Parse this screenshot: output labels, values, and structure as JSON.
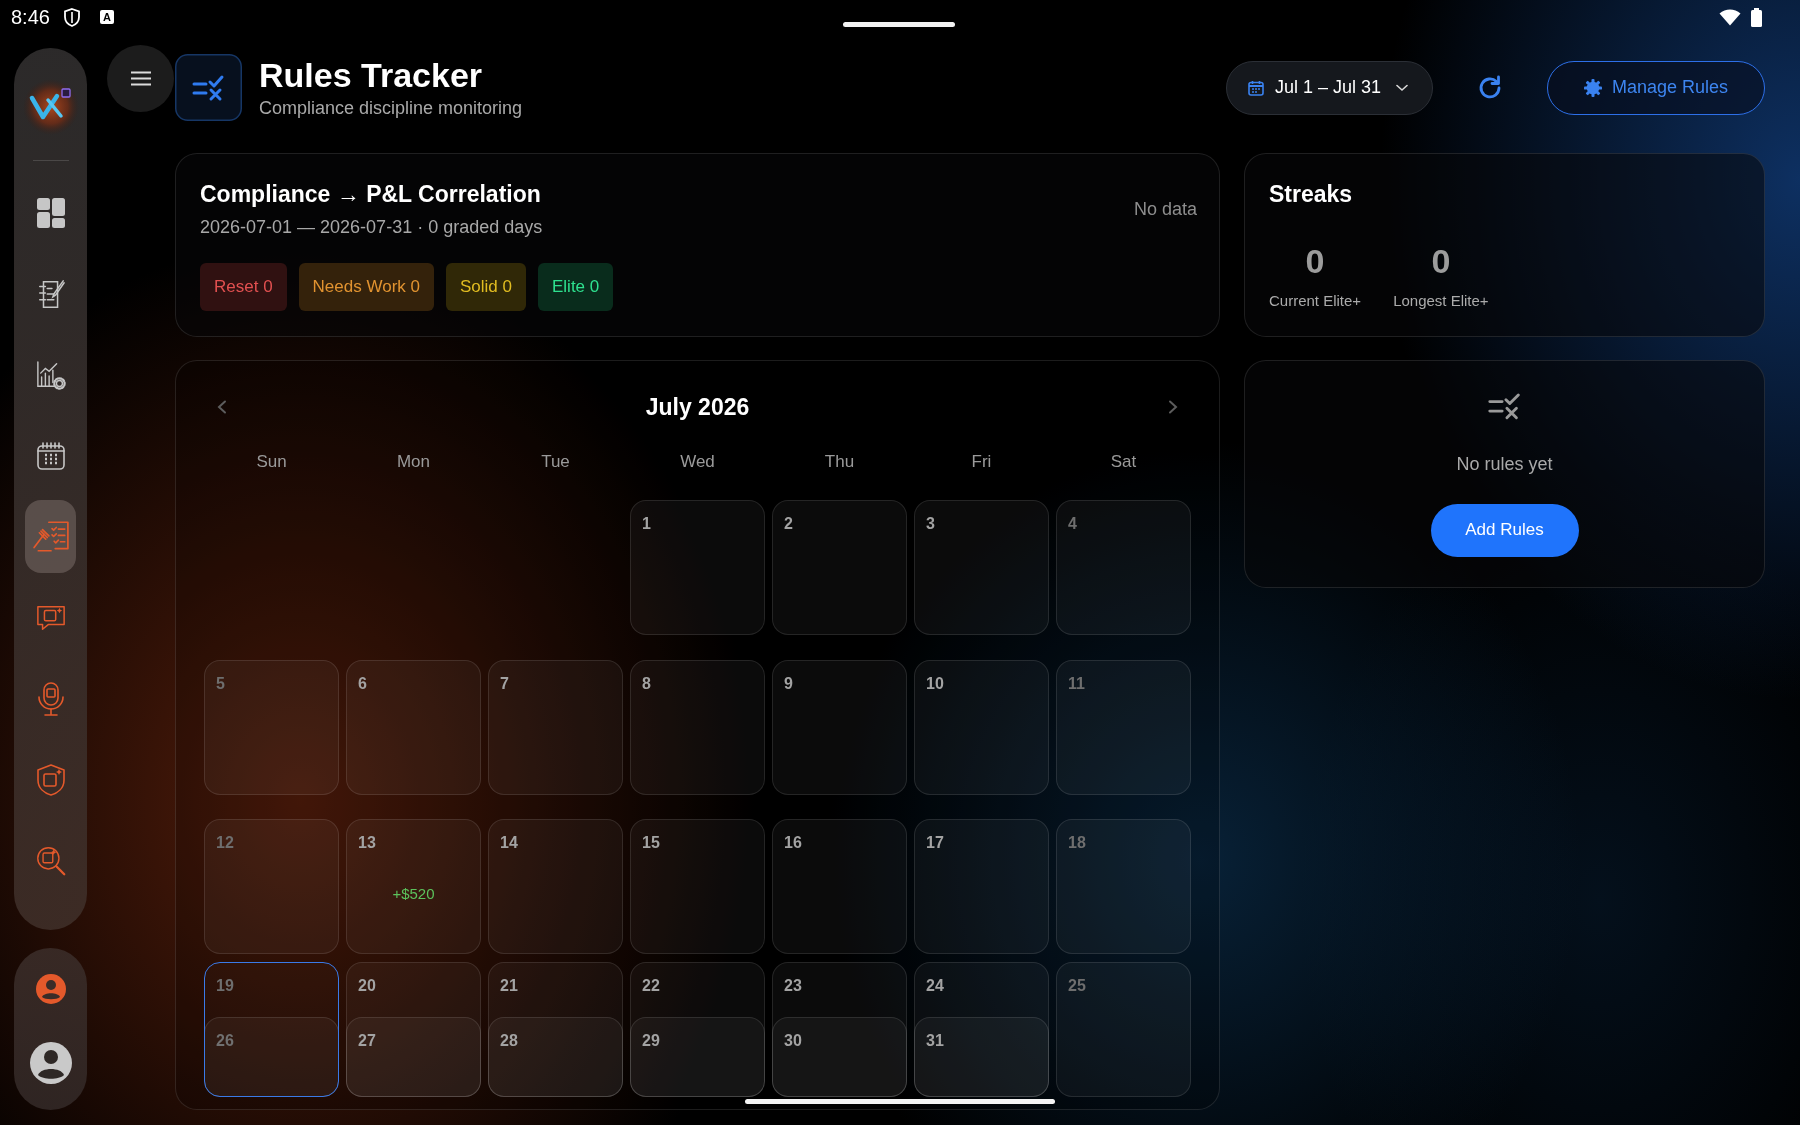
{
  "status_bar": {
    "time": "8:46",
    "notification": "A"
  },
  "sidebar": {
    "items": [
      {
        "selected": false
      },
      {
        "selected": false
      },
      {
        "selected": false
      },
      {
        "selected": false
      },
      {
        "selected": true
      },
      {
        "selected": false
      },
      {
        "selected": false
      },
      {
        "selected": false
      },
      {
        "selected": false
      }
    ]
  },
  "header": {
    "title": "Rules Tracker",
    "subtitle": "Compliance discipline monitoring",
    "date_range": "Jul 1 – Jul 31",
    "manage_button": "Manage Rules"
  },
  "correlation": {
    "title": "Compliance → P&L Correlation",
    "subtitle": "2026-07-01 — 2026-07-31 · 0 graded days",
    "status": "No data",
    "grades": [
      {
        "label": "Reset 0",
        "color": "#301111"
      },
      {
        "label": "Needs Work 0",
        "color": "#34220b"
      },
      {
        "label": "Solid 0",
        "color": "#302807"
      },
      {
        "label": "Elite 0",
        "color": "#092c1c"
      }
    ]
  },
  "streaks": {
    "title": "Streaks",
    "stats": [
      {
        "value": "0",
        "label": "Current Elite+"
      },
      {
        "value": "0",
        "label": "Longest Elite+"
      }
    ]
  },
  "rules": {
    "empty_text": "No rules yet",
    "add_button": "Add Rules"
  },
  "calendar": {
    "month": "July 2026",
    "weekdays": [
      "Sun",
      "Mon",
      "Tue",
      "Wed",
      "Thu",
      "Fri",
      "Sat"
    ],
    "weeks": [
      {
        "days": [
          {
            "label": "1",
            "selected": false
          },
          {
            "label": "2",
            "selected": false
          },
          {
            "label": "3",
            "selected": false
          },
          {
            "label": "4",
            "selected": false
          }
        ]
      },
      {
        "days": [
          {
            "label": "5",
            "selected": false
          },
          {
            "label": "6",
            "selected": false
          },
          {
            "label": "7",
            "selected": false
          },
          {
            "label": "8",
            "selected": false
          },
          {
            "label": "9",
            "selected": false
          },
          {
            "label": "10",
            "selected": false
          },
          {
            "label": "11",
            "selected": false
          }
        ]
      },
      {
        "days": [
          {
            "label": "12",
            "selected": false
          },
          {
            "label": "13",
            "selected": false,
            "pnl": "+$520"
          },
          {
            "label": "14",
            "selected": false
          },
          {
            "label": "15",
            "selected": false
          },
          {
            "label": "16",
            "selected": false
          },
          {
            "label": "17",
            "selected": false
          },
          {
            "label": "18",
            "selected": false
          }
        ]
      },
      {
        "days": [
          {
            "label": "19",
            "selected": true
          },
          {
            "label": "20",
            "selected": false
          },
          {
            "label": "21",
            "selected": false
          },
          {
            "label": "22",
            "selected": false
          },
          {
            "label": "23",
            "selected": false
          },
          {
            "label": "24",
            "selected": false
          },
          {
            "label": "25",
            "selected": false
          }
        ]
      },
      {
        "days": [
          {
            "label": "26",
            "selected": false
          },
          {
            "label": "27",
            "selected": false
          },
          {
            "label": "28",
            "selected": false
          },
          {
            "label": "29",
            "selected": false
          },
          {
            "label": "30",
            "selected": false
          },
          {
            "label": "31",
            "selected": false
          }
        ]
      }
    ]
  }
}
